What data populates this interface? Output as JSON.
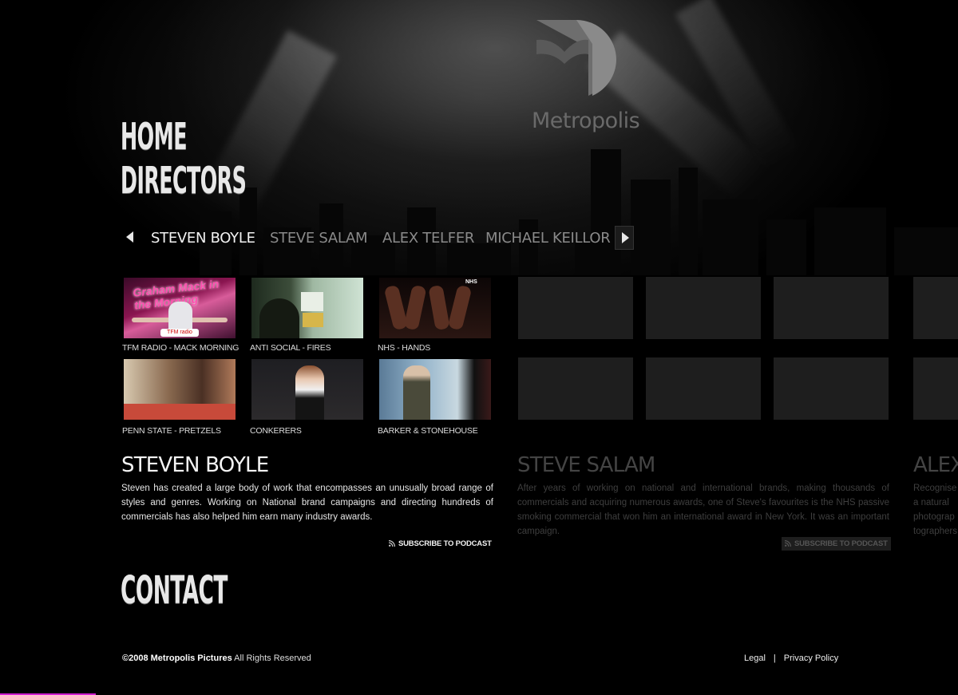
{
  "brand": {
    "logo_text": "Metropolis"
  },
  "nav": {
    "home": "HOME",
    "directors": "DIRECTORS",
    "contact": "CONTACT"
  },
  "directors_bar": {
    "items": [
      "STEVEN BOYLE",
      "STEVE SALAM",
      "ALEX TELFER",
      "MICHAEL KEILLOR"
    ],
    "active": "STEVEN BOYLE"
  },
  "works": [
    {
      "caption": "TFM RADIO - MACK MORNING",
      "thumb_text": "Graham Mack in the Morning",
      "badge": "TFM radio"
    },
    {
      "caption": "ANTI SOCIAL - FIRES"
    },
    {
      "caption": "NHS - HANDS",
      "badge": "NHS"
    },
    {
      "caption": "PENN STATE - PRETZELS"
    },
    {
      "caption": "CONKERERS"
    },
    {
      "caption": "BARKER & STONEHOUSE"
    }
  ],
  "bios": [
    {
      "name": "STEVEN BOYLE",
      "text": "Steven has created a large body of work that encompasses an unusually broad range of styles and genres. Working on National brand campaigns and directing hundreds of commercials has also helped him earn many industry awards.",
      "podcast": "SUBSCRIBE TO PODCAST"
    },
    {
      "name": "STEVE SALAM",
      "text": "After years of working on national and international brands, making thousands of commercials and acquiring numerous awards, one of Steve's favourites is the NHS passive smoking commercial that won him an international award in New York. It was an important campaign.",
      "podcast": "SUBSCRIBE TO PODCAST"
    },
    {
      "name": "ALEX",
      "text": "Recognise a natural photograp tographers"
    }
  ],
  "footer": {
    "copyright_strong": "©2008 Metropolis Pictures",
    "copyright_rest": "All Rights Reserved",
    "legal": "Legal",
    "separator": "|",
    "privacy": "Privacy Policy"
  },
  "colors": {
    "accent_pink": "#d020d0",
    "background": "#000000"
  }
}
